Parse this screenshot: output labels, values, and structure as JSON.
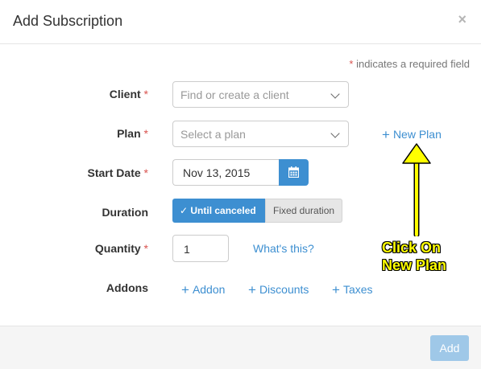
{
  "modal": {
    "title": "Add Subscription",
    "close_label": "×",
    "required_note_star": "*",
    "required_note": " indicates a required field"
  },
  "form": {
    "client": {
      "label": "Client",
      "required": "*",
      "placeholder": "Find or create a client"
    },
    "plan": {
      "label": "Plan",
      "required": "*",
      "placeholder": "Select a plan",
      "new_plan_link": "New Plan"
    },
    "start_date": {
      "label": "Start Date",
      "required": "*",
      "value": "Nov 13, 2015"
    },
    "duration": {
      "label": "Duration",
      "options": [
        "✓ Until canceled",
        "Fixed duration"
      ],
      "selected": "Until canceled"
    },
    "quantity": {
      "label": "Quantity",
      "required": "*",
      "value": "1",
      "help_link": "What's this?"
    },
    "addons": {
      "label": "Addons",
      "links": [
        "Addon",
        "Discounts",
        "Taxes"
      ]
    }
  },
  "footer": {
    "add_button": "Add"
  },
  "annotation": {
    "line1": "Click On",
    "line2": "New Plan"
  },
  "colors": {
    "accent": "#3d8fd1",
    "required": "#d9534f",
    "callout": "#ffff00"
  },
  "icons": {
    "calendar": "calendar-icon",
    "plus": "plus-icon",
    "dropdown": "chevron-down-icon"
  }
}
